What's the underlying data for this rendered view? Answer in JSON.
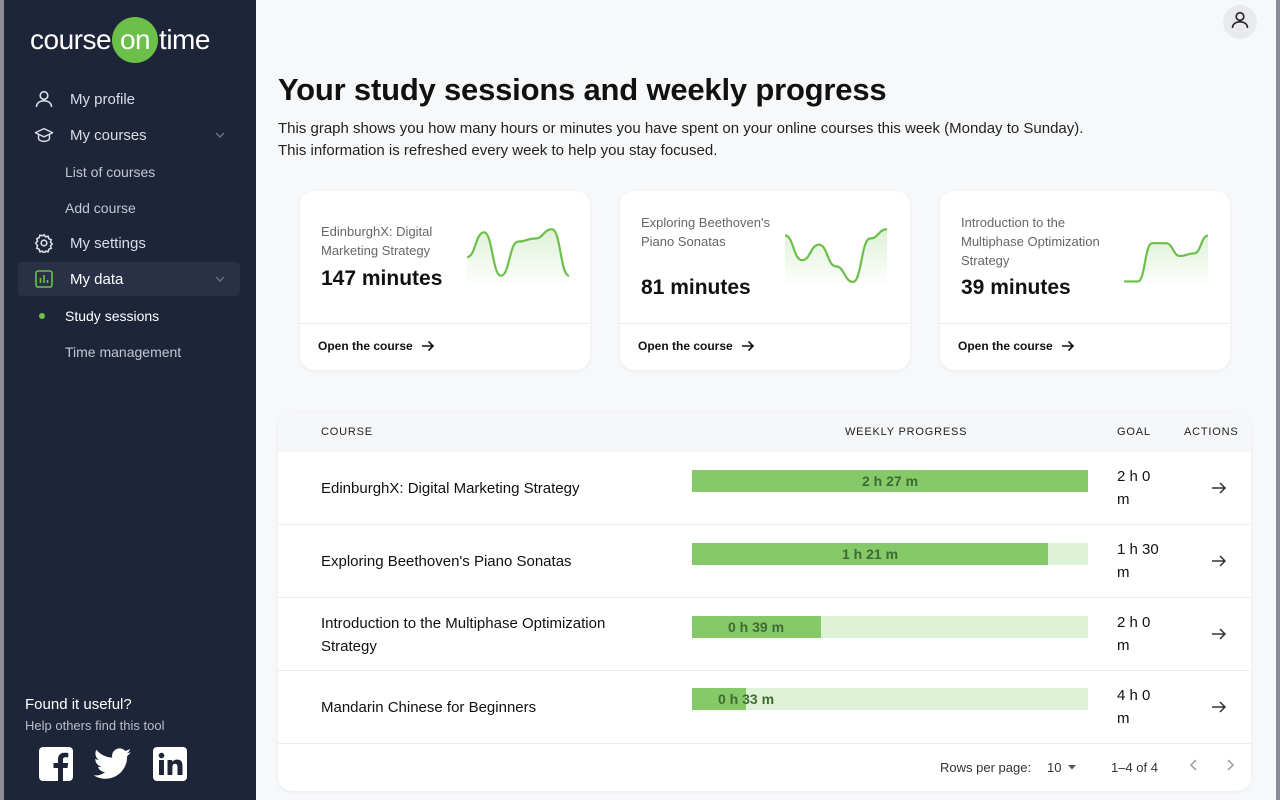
{
  "brand": {
    "part1": "course",
    "part2": "on",
    "part3": "time",
    "accent": "#6cc04a"
  },
  "sidebar": {
    "items": [
      {
        "label": "My profile",
        "icon": "user-icon"
      },
      {
        "label": "My courses",
        "icon": "graduation-cap-icon"
      },
      {
        "label": "List of courses"
      },
      {
        "label": "Add course"
      },
      {
        "label": "My settings",
        "icon": "gear-icon"
      },
      {
        "label": "My data",
        "icon": "bar-chart-icon"
      },
      {
        "label": "Study sessions"
      },
      {
        "label": "Time management"
      }
    ],
    "useful_heading": "Found it useful?",
    "useful_sub": "Help others find this tool",
    "social": [
      "facebook-icon",
      "twitter-icon",
      "linkedin-icon"
    ]
  },
  "header": {
    "profile_icon": "user-icon"
  },
  "main": {
    "title": "Your study sessions and weekly progress",
    "desc1": "This graph shows you how many hours or minutes you have spent on your online courses this week (Monday to Sunday).",
    "desc2": "This information is refreshed every week to help you stay focused."
  },
  "cards": [
    {
      "title": "EdinburghX: Digital Marketing Strategy",
      "value": "147 minutes",
      "link": "Open the course",
      "trend": [
        0.55,
        0.15,
        0.85,
        0.3,
        0.25,
        0.1,
        0.85
      ]
    },
    {
      "title": "Exploring Beethoven's Piano Sonatas",
      "value": "81 minutes",
      "link": "Open the course",
      "trend": [
        0.2,
        0.6,
        0.35,
        0.7,
        0.95,
        0.25,
        0.1
      ]
    },
    {
      "title": "Introduction to the Multiphase Optimization Strategy",
      "value": "39 minutes",
      "link": "Open the course",
      "trend": [
        0.95,
        0.95,
        0.2,
        0.2,
        0.45,
        0.4,
        0.05
      ]
    }
  ],
  "table": {
    "headers": {
      "course": "COURSE",
      "progress": "WEEKLY PROGRESS",
      "goal": "GOAL",
      "actions": "ACTIONS"
    },
    "rows": [
      {
        "course": "EdinburghX: Digital Marketing Strategy",
        "progress_label": "2 h 27 m",
        "progress": 1.0,
        "goal": "2 h 0 m"
      },
      {
        "course": "Exploring Beethoven's Piano Sonatas",
        "progress_label": "1 h 21 m",
        "progress": 0.9,
        "goal": "1 h 30 m"
      },
      {
        "course": "Introduction to the Multiphase Optimization Strategy",
        "progress_label": "0 h 39 m",
        "progress": 0.325,
        "goal": "2 h 0 m"
      },
      {
        "course": "Mandarin Chinese for Beginners",
        "progress_label": "0 h 33 m",
        "progress": 0.1375,
        "goal": "4 h 0 m"
      }
    ],
    "footer": {
      "rows_per_page_label": "Rows per page:",
      "rows_per_page": "10",
      "range": "1–4 of 4"
    }
  }
}
